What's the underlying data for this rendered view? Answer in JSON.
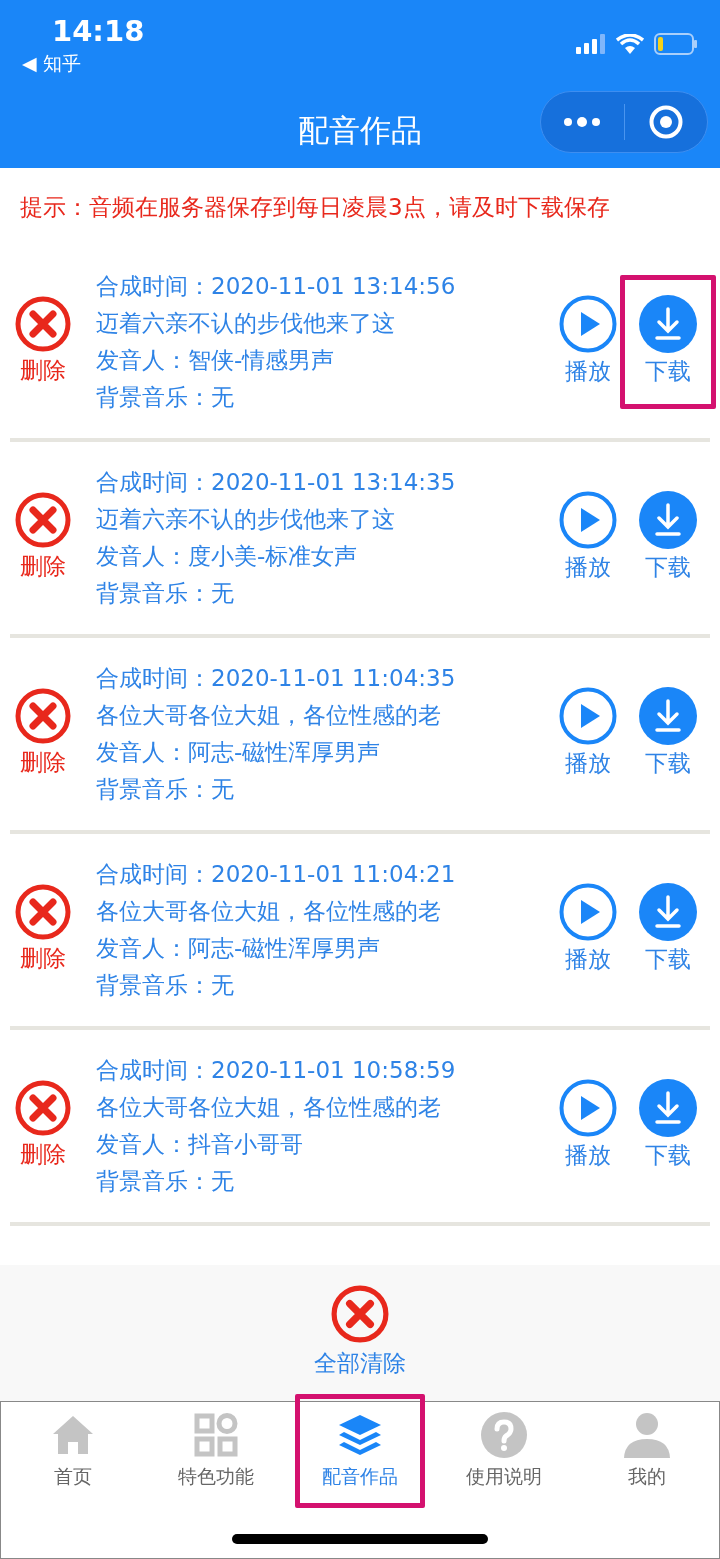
{
  "status_bar": {
    "time": "14:18",
    "back_app": "◀ 知乎"
  },
  "nav": {
    "title": "配音作品"
  },
  "notice": "提示：音频在服务器保存到每日凌晨3点，请及时下载保存",
  "works": [
    {
      "delete_label": "删除",
      "time": "合成时间：2020-11-01 13:14:56",
      "text": "迈着六亲不认的步伐他来了这",
      "voice": "发音人：智侠-情感男声",
      "music": "背景音乐：无",
      "play_label": "播放",
      "download_label": "下载",
      "download_highlighted": true
    },
    {
      "delete_label": "删除",
      "time": "合成时间：2020-11-01 13:14:35",
      "text": "迈着六亲不认的步伐他来了这",
      "voice": "发音人：度小美-标准女声",
      "music": "背景音乐：无",
      "play_label": "播放",
      "download_label": "下载",
      "download_highlighted": false
    },
    {
      "delete_label": "删除",
      "time": "合成时间：2020-11-01 11:04:35",
      "text": "各位大哥各位大姐，各位性感的老",
      "voice": "发音人：阿志-磁性浑厚男声",
      "music": "背景音乐：无",
      "play_label": "播放",
      "download_label": "下载",
      "download_highlighted": false
    },
    {
      "delete_label": "删除",
      "time": "合成时间：2020-11-01 11:04:21",
      "text": "各位大哥各位大姐，各位性感的老",
      "voice": "发音人：阿志-磁性浑厚男声",
      "music": "背景音乐：无",
      "play_label": "播放",
      "download_label": "下载",
      "download_highlighted": false
    },
    {
      "delete_label": "删除",
      "time": "合成时间：2020-11-01 10:58:59",
      "text": "各位大哥各位大姐，各位性感的老",
      "voice": "发音人：抖音小哥哥",
      "music": "背景音乐：无",
      "play_label": "播放",
      "download_label": "下载",
      "download_highlighted": false
    }
  ],
  "clear_all": "全部清除",
  "tabs": [
    {
      "kind": "home",
      "label": "首页",
      "selected": false,
      "highlighted": false
    },
    {
      "kind": "features",
      "label": "特色功能",
      "selected": false,
      "highlighted": false
    },
    {
      "kind": "works",
      "label": "配音作品",
      "selected": true,
      "highlighted": true
    },
    {
      "kind": "help",
      "label": "使用说明",
      "selected": false,
      "highlighted": false
    },
    {
      "kind": "profile",
      "label": "我的",
      "selected": false,
      "highlighted": false
    }
  ]
}
